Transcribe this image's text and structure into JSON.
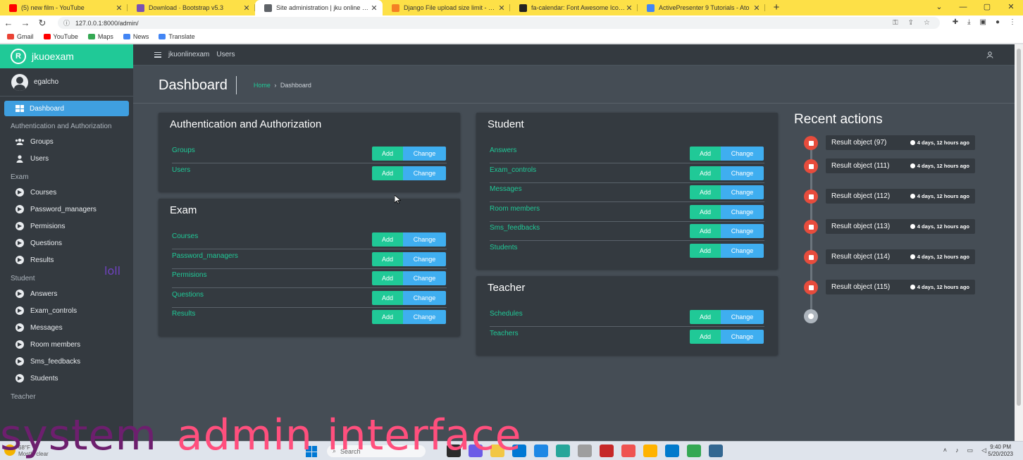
{
  "browser": {
    "tabs": [
      {
        "title": "(5) new film - YouTube",
        "color": "#ff0000"
      },
      {
        "title": "Download · Bootstrap v5.3",
        "color": "#7952b3"
      },
      {
        "title": "Site administration | jku online exam",
        "color": "#5f6368",
        "active": true
      },
      {
        "title": "Django File upload size limit - Sta",
        "color": "#f48024"
      },
      {
        "title": "fa-calendar: Font Awesome Icons",
        "color": "#222222"
      },
      {
        "title": "ActivePresenter 9 Tutorials - Ato",
        "color": "#4285f4"
      }
    ],
    "url": "127.0.0.1:8000/admin/",
    "bookmarks": [
      {
        "label": "Gmail",
        "color": "#ea4335"
      },
      {
        "label": "YouTube",
        "color": "#ff0000"
      },
      {
        "label": "Maps",
        "color": "#34a853"
      },
      {
        "label": "News",
        "color": "#4285f4"
      },
      {
        "label": "Translate",
        "color": "#4285f4"
      }
    ]
  },
  "sidebar": {
    "brand": "jkuoexam",
    "username": "egalcho",
    "active_item": "Dashboard",
    "sections": [
      {
        "heading": "Authentication and Authorization",
        "items": [
          {
            "label": "Groups",
            "icon": "users-icon"
          },
          {
            "label": "Users",
            "icon": "user-icon"
          }
        ]
      },
      {
        "heading": "Exam",
        "items": [
          {
            "label": "Courses",
            "icon": "arrow-circle-icon"
          },
          {
            "label": "Password_managers",
            "icon": "arrow-circle-icon"
          },
          {
            "label": "Permisions",
            "icon": "arrow-circle-icon"
          },
          {
            "label": "Questions",
            "icon": "arrow-circle-icon"
          },
          {
            "label": "Results",
            "icon": "arrow-circle-icon"
          }
        ]
      },
      {
        "heading": "Student",
        "items": [
          {
            "label": "Answers",
            "icon": "arrow-circle-icon"
          },
          {
            "label": "Exam_controls",
            "icon": "arrow-circle-icon"
          },
          {
            "label": "Messages",
            "icon": "arrow-circle-icon"
          },
          {
            "label": "Room members",
            "icon": "arrow-circle-icon"
          },
          {
            "label": "Sms_feedbacks",
            "icon": "arrow-circle-icon"
          },
          {
            "label": "Students",
            "icon": "arrow-circle-icon"
          }
        ]
      },
      {
        "heading": "Teacher",
        "items": []
      }
    ],
    "loll": "loll"
  },
  "topnav": {
    "link1": "jkuonlinexam",
    "link2": "Users"
  },
  "page": {
    "title": "Dashboard",
    "breadcrumb_home": "Home",
    "breadcrumb_sep": "›",
    "breadcrumb_current": "Dashboard"
  },
  "buttons": {
    "add": "Add",
    "change": "Change"
  },
  "cards": {
    "auth": {
      "title": "Authentication and Authorization",
      "models": [
        "Groups",
        "Users"
      ]
    },
    "exam": {
      "title": "Exam",
      "models": [
        "Courses",
        "Password_managers",
        "Permisions",
        "Questions",
        "Results"
      ]
    },
    "student": {
      "title": "Student",
      "models": [
        "Answers",
        "Exam_controls",
        "Messages",
        "Room members",
        "Sms_feedbacks",
        "Students"
      ]
    },
    "teacher": {
      "title": "Teacher",
      "models": [
        "Schedules",
        "Teachers"
      ]
    }
  },
  "recent": {
    "title": "Recent actions",
    "items": [
      {
        "object": "Result object (97)",
        "time": "4 days, 12 hours ago"
      },
      {
        "object": "Result object (111)",
        "time": "4 days, 12 hours ago"
      },
      {
        "object": "Result object (112)",
        "time": "4 days, 12 hours ago"
      },
      {
        "object": "Result object (113)",
        "time": "4 days, 12 hours ago"
      },
      {
        "object": "Result object (114)",
        "time": "4 days, 12 hours ago"
      },
      {
        "object": "Result object (115)",
        "time": "4 days, 12 hours ago"
      }
    ]
  },
  "taskbar": {
    "search": "Search",
    "weather_temp": "68°F",
    "weather_desc": "Mostly clear",
    "time": "9:40 PM",
    "date": "5/20/2023"
  },
  "overlay": {
    "word1": "system",
    "word2": "admin interface"
  },
  "colors": {
    "accent": "#20c997",
    "change": "#3faef0",
    "sidebar": "#343a40",
    "content": "#454d55",
    "danger": "#e74c3c"
  }
}
